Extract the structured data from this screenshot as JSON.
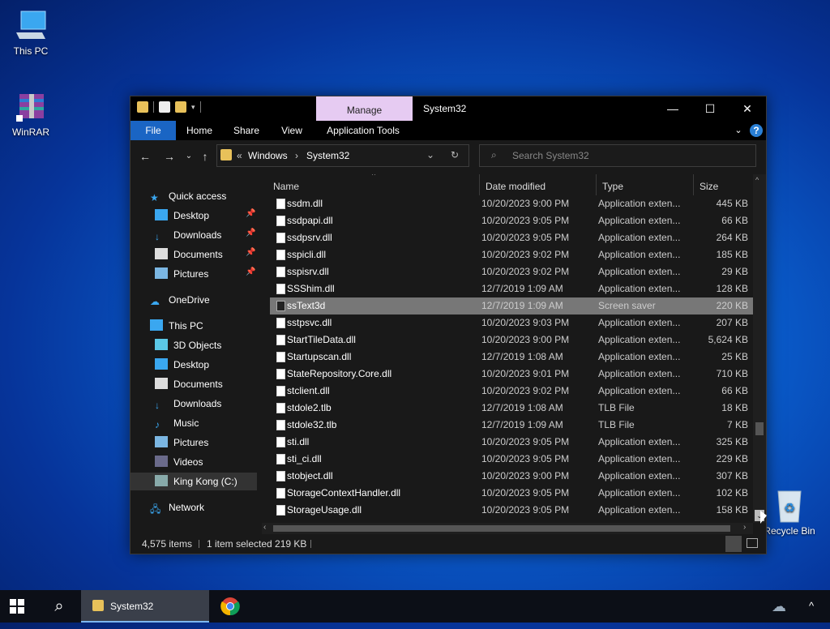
{
  "desktop": {
    "icons": [
      {
        "label": "This PC",
        "icon": "computer-icon"
      },
      {
        "label": "WinRAR",
        "icon": "winrar-icon"
      },
      {
        "label": "Recycle Bin",
        "icon": "recycle-bin-icon"
      }
    ]
  },
  "window": {
    "title": "System32",
    "manage_tab": "Manage",
    "controls": {
      "minimize": "—",
      "maximize": "☐",
      "close": "✕"
    },
    "ribbon_tabs": [
      "File",
      "Home",
      "Share",
      "View",
      "Application Tools"
    ],
    "address": {
      "prefix": "«",
      "segments": [
        "Windows",
        "System32"
      ]
    },
    "search": {
      "placeholder": "Search System32"
    },
    "nav": {
      "quick_access": "Quick access",
      "quick_items": [
        "Desktop",
        "Downloads",
        "Documents",
        "Pictures"
      ],
      "onedrive": "OneDrive",
      "this_pc": "This PC",
      "pc_items": [
        "3D Objects",
        "Desktop",
        "Documents",
        "Downloads",
        "Music",
        "Pictures",
        "Videos",
        "King Kong  (C:)"
      ],
      "network": "Network"
    },
    "columns": {
      "name": "Name",
      "date": "Date modified",
      "type": "Type",
      "size": "Size"
    },
    "files": [
      {
        "name": "ssdm.dll",
        "date": "10/20/2023 9:00 PM",
        "type": "Application exten...",
        "size": "445 KB"
      },
      {
        "name": "ssdpapi.dll",
        "date": "10/20/2023 9:05 PM",
        "type": "Application exten...",
        "size": "66 KB"
      },
      {
        "name": "ssdpsrv.dll",
        "date": "10/20/2023 9:05 PM",
        "type": "Application exten...",
        "size": "264 KB"
      },
      {
        "name": "sspicli.dll",
        "date": "10/20/2023 9:02 PM",
        "type": "Application exten...",
        "size": "185 KB"
      },
      {
        "name": "sspisrv.dll",
        "date": "10/20/2023 9:02 PM",
        "type": "Application exten...",
        "size": "29 KB"
      },
      {
        "name": "SSShim.dll",
        "date": "12/7/2019 1:09 AM",
        "type": "Application exten...",
        "size": "128 KB"
      },
      {
        "name": "ssText3d",
        "date": "12/7/2019 1:09 AM",
        "type": "Screen saver",
        "size": "220 KB",
        "selected": true
      },
      {
        "name": "sstpsvc.dll",
        "date": "10/20/2023 9:03 PM",
        "type": "Application exten...",
        "size": "207 KB"
      },
      {
        "name": "StartTileData.dll",
        "date": "10/20/2023 9:00 PM",
        "type": "Application exten...",
        "size": "5,624 KB"
      },
      {
        "name": "Startupscan.dll",
        "date": "12/7/2019 1:08 AM",
        "type": "Application exten...",
        "size": "25 KB"
      },
      {
        "name": "StateRepository.Core.dll",
        "date": "10/20/2023 9:01 PM",
        "type": "Application exten...",
        "size": "710 KB"
      },
      {
        "name": "stclient.dll",
        "date": "10/20/2023 9:02 PM",
        "type": "Application exten...",
        "size": "66 KB"
      },
      {
        "name": "stdole2.tlb",
        "date": "12/7/2019 1:08 AM",
        "type": "TLB File",
        "size": "18 KB"
      },
      {
        "name": "stdole32.tlb",
        "date": "12/7/2019 1:09 AM",
        "type": "TLB File",
        "size": "7 KB"
      },
      {
        "name": "sti.dll",
        "date": "10/20/2023 9:05 PM",
        "type": "Application exten...",
        "size": "325 KB"
      },
      {
        "name": "sti_ci.dll",
        "date": "10/20/2023 9:05 PM",
        "type": "Application exten...",
        "size": "229 KB"
      },
      {
        "name": "stobject.dll",
        "date": "10/20/2023 9:00 PM",
        "type": "Application exten...",
        "size": "307 KB"
      },
      {
        "name": "StorageContextHandler.dll",
        "date": "10/20/2023 9:05 PM",
        "type": "Application exten...",
        "size": "102 KB"
      },
      {
        "name": "StorageUsage.dll",
        "date": "10/20/2023 9:05 PM",
        "type": "Application exten...",
        "size": "158 KB"
      }
    ],
    "status": {
      "count": "4,575 items",
      "selected": "1 item selected  219 KB"
    }
  },
  "taskbar": {
    "active_item": "System32"
  }
}
